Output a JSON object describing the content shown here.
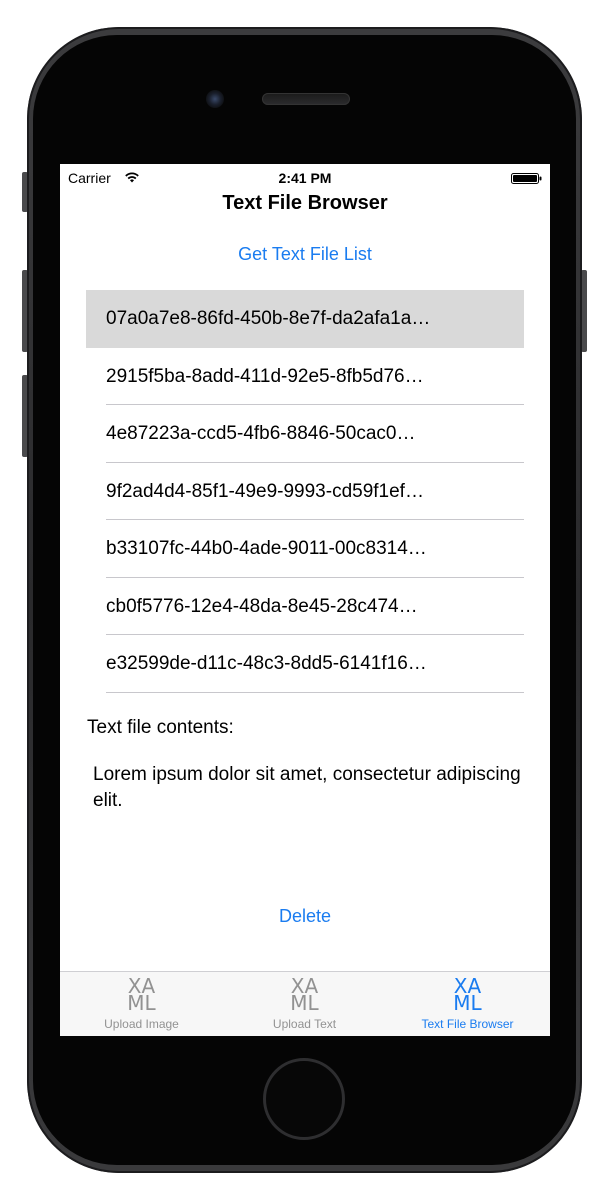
{
  "status_bar": {
    "carrier": "Carrier",
    "time": "2:41 PM"
  },
  "nav": {
    "title": "Text File Browser"
  },
  "actions": {
    "get_list_label": "Get Text File List",
    "delete_label": "Delete"
  },
  "files": [
    "07a0a7e8-86fd-450b-8e7f-da2afa1a…",
    "2915f5ba-8add-411d-92e5-8fb5d76…",
    "4e87223a-ccd5-4fb6-8846-50cac0…",
    "9f2ad4d4-85f1-49e9-9993-cd59f1ef…",
    "b33107fc-44b0-4ade-9011-00c8314…",
    "cb0f5776-12e4-48da-8e45-28c474…",
    "e32599de-d11c-48c3-8dd5-6141f16…"
  ],
  "selected_file_index": 0,
  "contents": {
    "label": "Text file contents:",
    "text": "Lorem ipsum dolor sit amet, consectetur adipiscing elit."
  },
  "tabs": [
    {
      "icon_line1": "XA",
      "icon_line2": "ML",
      "label": "Upload Image",
      "icon": "xaml-icon",
      "active": false
    },
    {
      "icon_line1": "XA",
      "icon_line2": "ML",
      "label": "Upload Text",
      "icon": "xaml-icon",
      "active": false
    },
    {
      "icon_line1": "XA",
      "icon_line2": "ML",
      "label": "Text File Browser",
      "icon": "xaml-icon",
      "active": true
    }
  ],
  "colors": {
    "accent": "#1a7cf0",
    "selected_row": "#d9d9d9",
    "tab_inactive": "#929292"
  }
}
